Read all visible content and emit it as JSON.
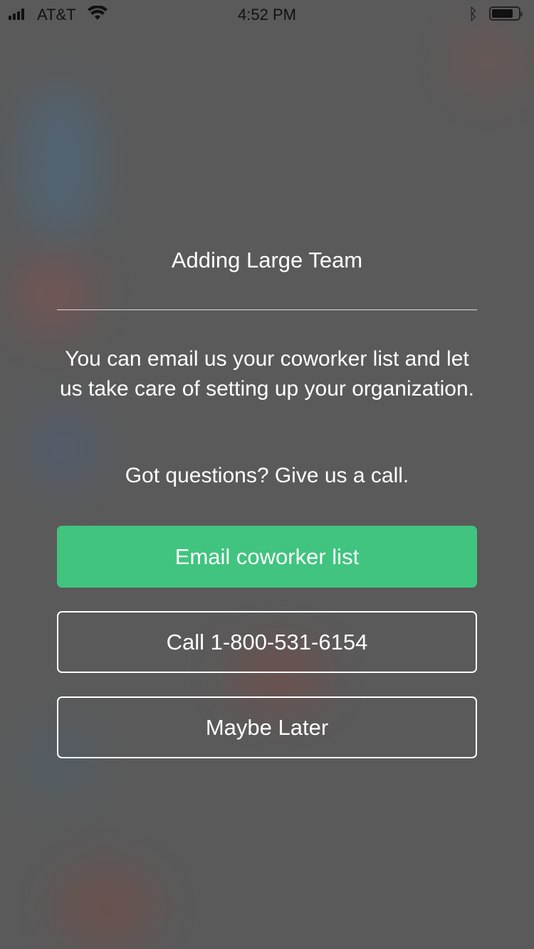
{
  "status_bar": {
    "carrier": "AT&T",
    "time": "4:52 PM",
    "battery_level": 0.8
  },
  "dialog": {
    "title": "Adding Large Team",
    "message": "You can email us your coworker list and let us take care of setting up your organization.",
    "question": "Got questions? Give us a call.",
    "buttons": {
      "email": "Email coworker list",
      "call": "Call 1-800-531-6154",
      "later": "Maybe Later"
    }
  },
  "colors": {
    "accent": "#40c47f",
    "background": "#5a5a5a"
  }
}
